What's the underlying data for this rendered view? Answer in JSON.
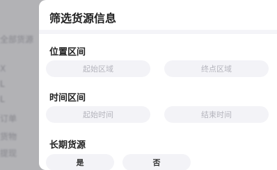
{
  "background": {
    "items": [
      "全部货源",
      "X",
      "L",
      "L",
      "订单",
      "货物",
      "提现"
    ]
  },
  "filter_panel": {
    "title": "筛选货源信息",
    "location_section": {
      "label": "位置区间",
      "start_placeholder": "起始区域",
      "end_placeholder": "终点区域"
    },
    "time_section": {
      "label": "时间区间",
      "start_placeholder": "起始时间",
      "end_placeholder": "结束时间"
    },
    "long_term_section": {
      "label": "长期货源",
      "options": [
        "是",
        "否"
      ]
    }
  },
  "colors": {
    "panel_bg": "#ffffff",
    "pill_bg": "#f3f3f7",
    "placeholder_text": "#b5b5bd",
    "title_text": "#1f1f1f",
    "scrim": "#6e6e73"
  }
}
